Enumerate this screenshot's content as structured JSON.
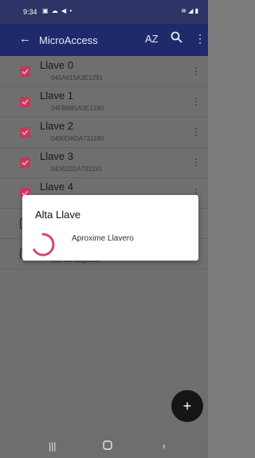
{
  "status": {
    "time": "9:34",
    "icons": [
      "gallery-icon",
      "cloud-icon",
      "send-icon",
      "dot-icon"
    ],
    "right_icons": [
      "wifi-icon",
      "signal-icon",
      "battery-icon"
    ]
  },
  "appbar": {
    "title": "MicroAccess",
    "sort_label": "AZ"
  },
  "keys": [
    {
      "name": "Llave 0",
      "uid": "045A615A3E1291",
      "checked": true
    },
    {
      "name": "Llave 1",
      "uid": "04FB8B5A3E1290",
      "checked": true
    },
    {
      "name": "Llave 2",
      "uid": "0490DADA731190",
      "checked": true
    },
    {
      "name": "Llave 3",
      "uid": "043622DA731191",
      "checked": true
    },
    {
      "name": "Llave 4",
      "uid": "",
      "checked": true
    },
    {
      "name": "",
      "uid": "",
      "checked": false
    },
    {
      "name": "",
      "uid": "UID No asignada",
      "checked": false
    }
  ],
  "dialog": {
    "title": "Alta Llave",
    "message": "Aproxime Llavero"
  },
  "fab": {
    "label": "+"
  },
  "colors": {
    "primary_dark": "#2e3566",
    "primary": "#1e2a6a",
    "accent": "#c23a5b"
  }
}
